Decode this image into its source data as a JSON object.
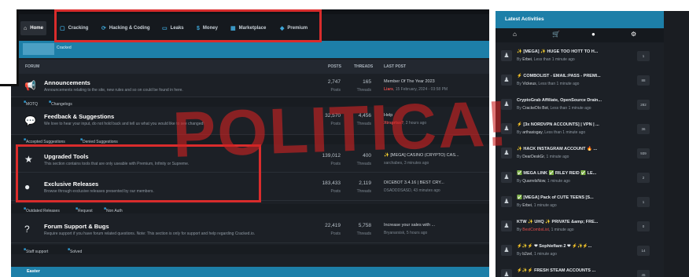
{
  "nav": {
    "home": "Home",
    "items": [
      {
        "icon": "cracking-icon",
        "glyph": "▢",
        "label": "Cracking"
      },
      {
        "icon": "hacking-icon",
        "glyph": "⟳",
        "label": "Hacking & Coding"
      },
      {
        "icon": "leaks-icon",
        "glyph": "▭",
        "label": "Leaks"
      },
      {
        "icon": "money-icon",
        "glyph": "$",
        "label": "Money"
      },
      {
        "icon": "marketplace-icon",
        "glyph": "▦",
        "label": "Marketplace"
      },
      {
        "icon": "premium-icon",
        "glyph": "◆",
        "label": "Premium"
      }
    ]
  },
  "banner": {
    "label": "Cracked"
  },
  "columns": {
    "forum": "FORUM",
    "posts": "POSTS",
    "threads": "THREADS",
    "last_post": "LAST POST"
  },
  "forums": [
    {
      "title": "Announcements",
      "desc": "Announcements relating to the site, new rules and so on could be found in here.",
      "posts": "2,747",
      "posts_label": "Posts",
      "threads": "165",
      "threads_label": "Threads",
      "last_title": "Member Of The Year 2023",
      "last_user": "Liars",
      "last_time": ", 15 February, 2024 - 03:58 PM"
    },
    {
      "title": "Feedback & Suggestions",
      "desc": "We love to hear your input, do not hold back and tell us what you would like to see changed!",
      "posts": "32,570",
      "posts_label": "Posts",
      "threads": "4,456",
      "threads_label": "Threads",
      "last_title": "Help",
      "last_user": "Xtrsprtss?",
      "last_time": ", 2 hours ago"
    },
    {
      "title": "Upgraded Tools",
      "desc": "This section contains tools that are only useable with Premium, Infinity or Supreme.",
      "posts": "139,012",
      "posts_label": "Posts",
      "threads": "400",
      "threads_label": "Threads",
      "last_title": "✨ [MEGA] CASINO (CRYPTO) CAS...",
      "last_user": "xarchabes",
      "last_time": ", 3 minutes ago"
    },
    {
      "title": "Exclusive Releases",
      "desc": "Browse through exclusive releases presented by our members.",
      "posts": "183,433",
      "posts_label": "Posts",
      "threads": "2,119",
      "threads_label": "Threads",
      "last_title": "DICEBOT 3.4.16 | BEST CRY...",
      "last_user": "DSADDDSASD",
      "last_time": ", 43 minutes ago"
    },
    {
      "title": "Forum Support & Bugs",
      "desc": "Require support if you have forum related questions. Note: This section is only for support and help regarding Cracked.io.",
      "posts": "22,419",
      "posts_label": "Posts",
      "threads": "5,758",
      "threads_label": "Threads",
      "last_title": "Increase your sales with ...",
      "last_user": "Bryanarsisk",
      "last_time": ", 5 hours ago"
    }
  ],
  "subforums": {
    "announcements": [
      "MOTQ",
      "Changelogs"
    ],
    "feedback": [
      "Accepted Suggestions",
      "Denied Suggestions"
    ],
    "exclusive": [
      "Outdated Releases",
      "Request",
      "Non Auth"
    ],
    "support": [
      "Staff support",
      "Solved"
    ]
  },
  "bottom_category": "Easter",
  "stamp": "POLITICA!",
  "activity": {
    "title": "Latest Activities",
    "items": [
      {
        "title": "✨ [MEGA] ✨ HUGE TOO HOTT TO H...",
        "by": "By ",
        "user": "Erbei",
        "time": ", Less than 1 minute ago",
        "count": "1"
      },
      {
        "title": "⚡ COMBOLIST - EMAIL:PASS - PREMI...",
        "by": "By ",
        "user": "Vickeus",
        "time": ", Less than 1 minute ago",
        "count": "88"
      },
      {
        "title": "CryptoGrab Affiliate, OpenSource Drain...",
        "by": "By ",
        "user": "CrackeDIo Bot",
        "time": ", Less than 1 minute ago",
        "count": "282"
      },
      {
        "title": "⚡ [3x NORDVPN ACCOUNTS] | VPN | ...",
        "by": "By ",
        "user": "arthasisgay",
        "time": ", Less than 1 minute ago",
        "count": "36"
      },
      {
        "title": "✨ HACK INSTAGRAM ACCOUNT 🔥 ...",
        "by": "By ",
        "user": "DearDeskGr",
        "time": ", 1 minute ago",
        "count": "939"
      },
      {
        "title": "✅ MEGA LINK ✅ RILEY REID ✅ LE...",
        "by": "By ",
        "user": "QuarrelsNow",
        "time": ", 1 minute ago",
        "count": "2"
      },
      {
        "title": "✅ [MEGA] Pack of CUTE TEENS [S...",
        "by": "By ",
        "user": "Erbei",
        "time": ", 1 minute ago",
        "count": "1"
      },
      {
        "title": "KTW ✨ UHQ ✨ PRIVATE &amp; FRE...",
        "by": "By ",
        "user": "BestCombsList",
        "time": ", 1 minute ago",
        "count": "0"
      },
      {
        "title": "⚡✨⚡ ❤ Sophiefiam 2 ❤ ⚡✨⚡...",
        "by": "By ",
        "user": "b2zel",
        "time": ", 1 minute ago",
        "count": "14"
      },
      {
        "title": "⚡✨⚡ FRESH STEAM ACCOUNTS ...",
        "by": "By ",
        "user": "",
        "time": "",
        "count": "45"
      }
    ]
  }
}
